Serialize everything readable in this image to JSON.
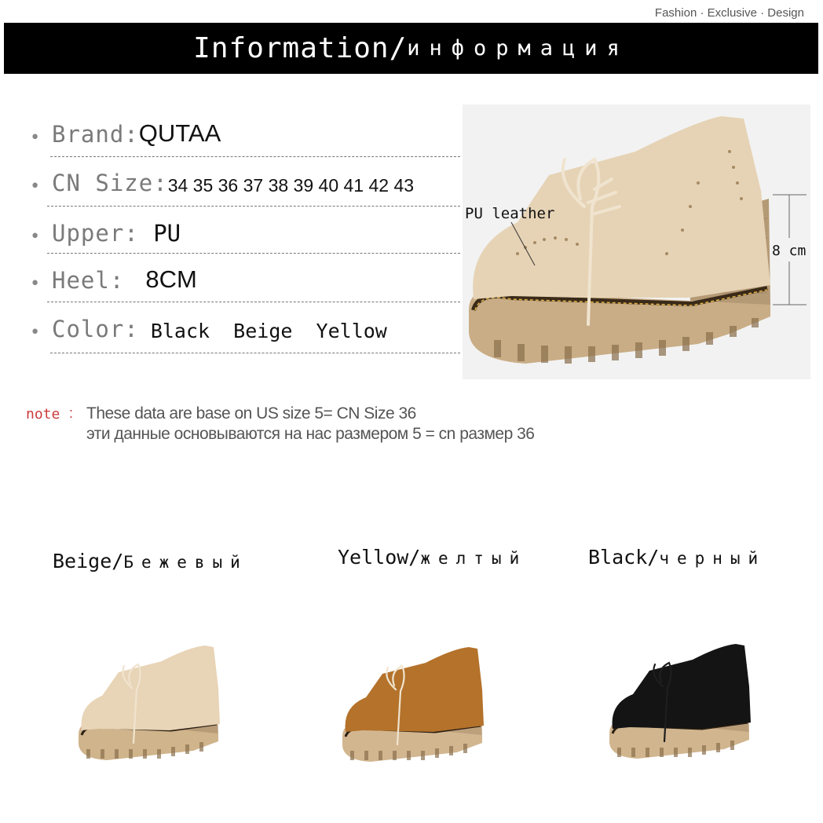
{
  "header": {
    "tagline": "Fashion · Exclusive · Design",
    "title": "Information/",
    "title_ru": "информация"
  },
  "specs": [
    {
      "label": "Brand:",
      "value": "QUTAA"
    },
    {
      "label": "CN Size:",
      "value": "34 35 36 37 38 39 40 41 42 43"
    },
    {
      "label": "Upper: ",
      "value": "PU"
    },
    {
      "label": "Heel: ",
      "value": " 8CM"
    },
    {
      "label": "Color:",
      "value": " Black  Beige  Yellow"
    }
  ],
  "photo": {
    "material_label": "PU leather",
    "height_label": "8 cm",
    "colors": {
      "upper": "#e6d3b5",
      "sole": "#c9ad86",
      "heel": "#b59a76",
      "lace": "#f0e4cf"
    }
  },
  "note": {
    "key": "note",
    "separator": ":",
    "line_en": "These data are base on US size 5= CN Size 36",
    "line_ru": "эти данные основываются на нас размером 5 = cn размер 36"
  },
  "variants": [
    {
      "name": "Beige/",
      "name_ru": "Бежевый",
      "upper": "#e8d4b6",
      "sole": "#cfb48c",
      "heel": "#b89c78"
    },
    {
      "name": "Yellow/",
      "name_ru": "желтый",
      "upper": "#b4722b",
      "sole": "#d2b690",
      "heel": "#bca07c"
    },
    {
      "name": "Black/",
      "name_ru": "черный",
      "upper": "#141414",
      "sole": "#d0b58e",
      "heel": "#b99d79"
    }
  ]
}
